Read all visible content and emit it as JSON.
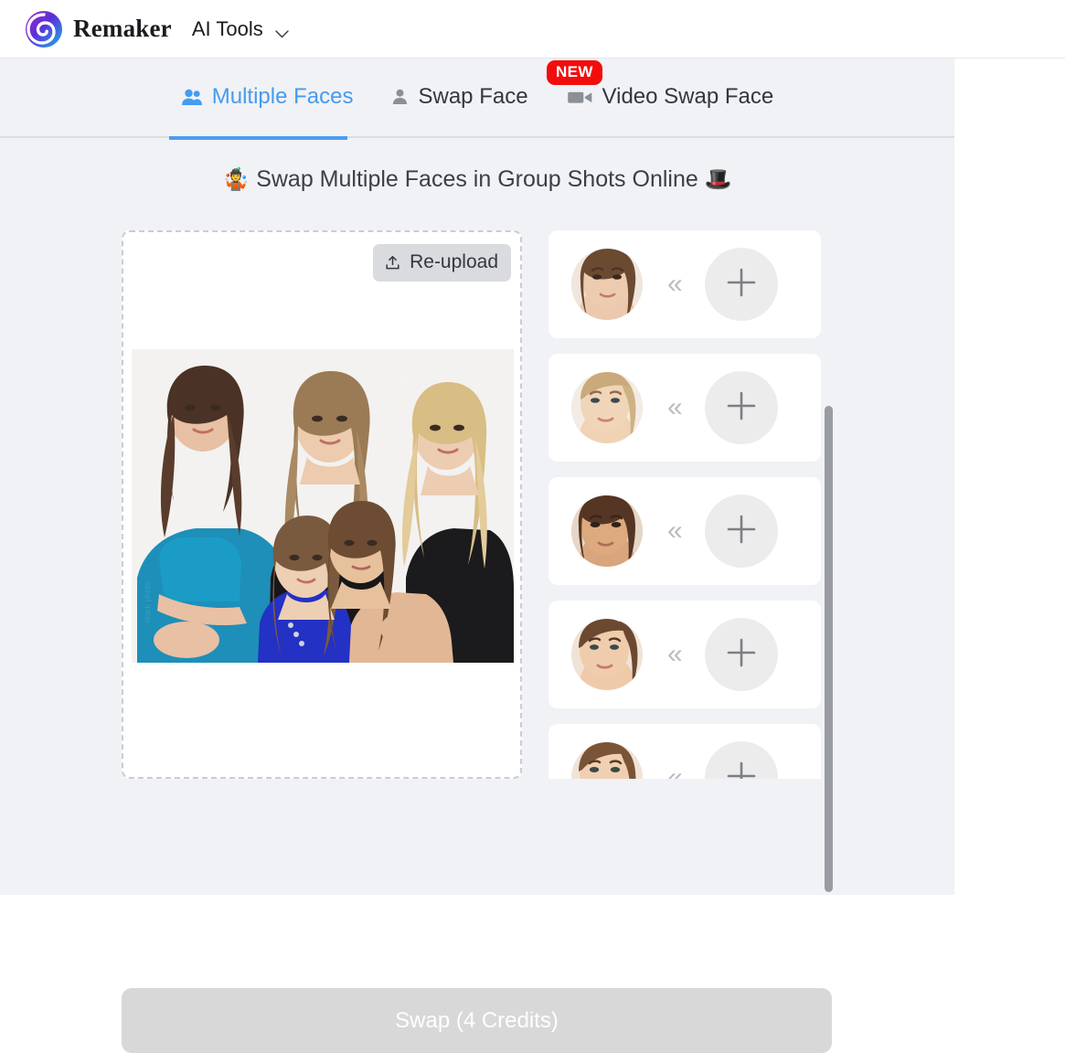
{
  "header": {
    "brand_name": "Remaker",
    "nav_menu_label": "AI Tools",
    "logo_icon": "remaker-spiral-logo",
    "chevron_icon": "chevron-down-icon"
  },
  "tabs": [
    {
      "label": "Multiple Faces",
      "icon": "multiple-faces-icon",
      "active": true,
      "badge": ""
    },
    {
      "label": "Swap Face",
      "icon": "single-person-icon",
      "active": false,
      "badge": ""
    },
    {
      "label": "Video Swap Face",
      "icon": "video-camera-icon",
      "active": false,
      "badge": "NEW"
    }
  ],
  "badge": {
    "new_label": "NEW"
  },
  "heading": {
    "emoji_left": "🤹",
    "text": "Swap Multiple Faces in Group Shots Online",
    "emoji_right": "🎩"
  },
  "upload": {
    "reupload_label": "Re-upload",
    "upload_icon": "upload-icon",
    "image_alt": "group-photo-five-women"
  },
  "faces": {
    "chevron_glyph": "«",
    "add_icon": "plus-icon",
    "items": [
      {
        "face_label": "detected-face-1"
      },
      {
        "face_label": "detected-face-2"
      },
      {
        "face_label": "detected-face-3"
      },
      {
        "face_label": "detected-face-4"
      },
      {
        "face_label": "detected-face-5"
      }
    ]
  },
  "action": {
    "swap_label": "Swap (4 Credits)"
  },
  "colors": {
    "accent": "#459bf0",
    "badge_red": "#f20d0d",
    "panel_bg": "#f0f2f5",
    "button_disabled": "#d8d8d8",
    "card_bg": "#ffffff"
  }
}
